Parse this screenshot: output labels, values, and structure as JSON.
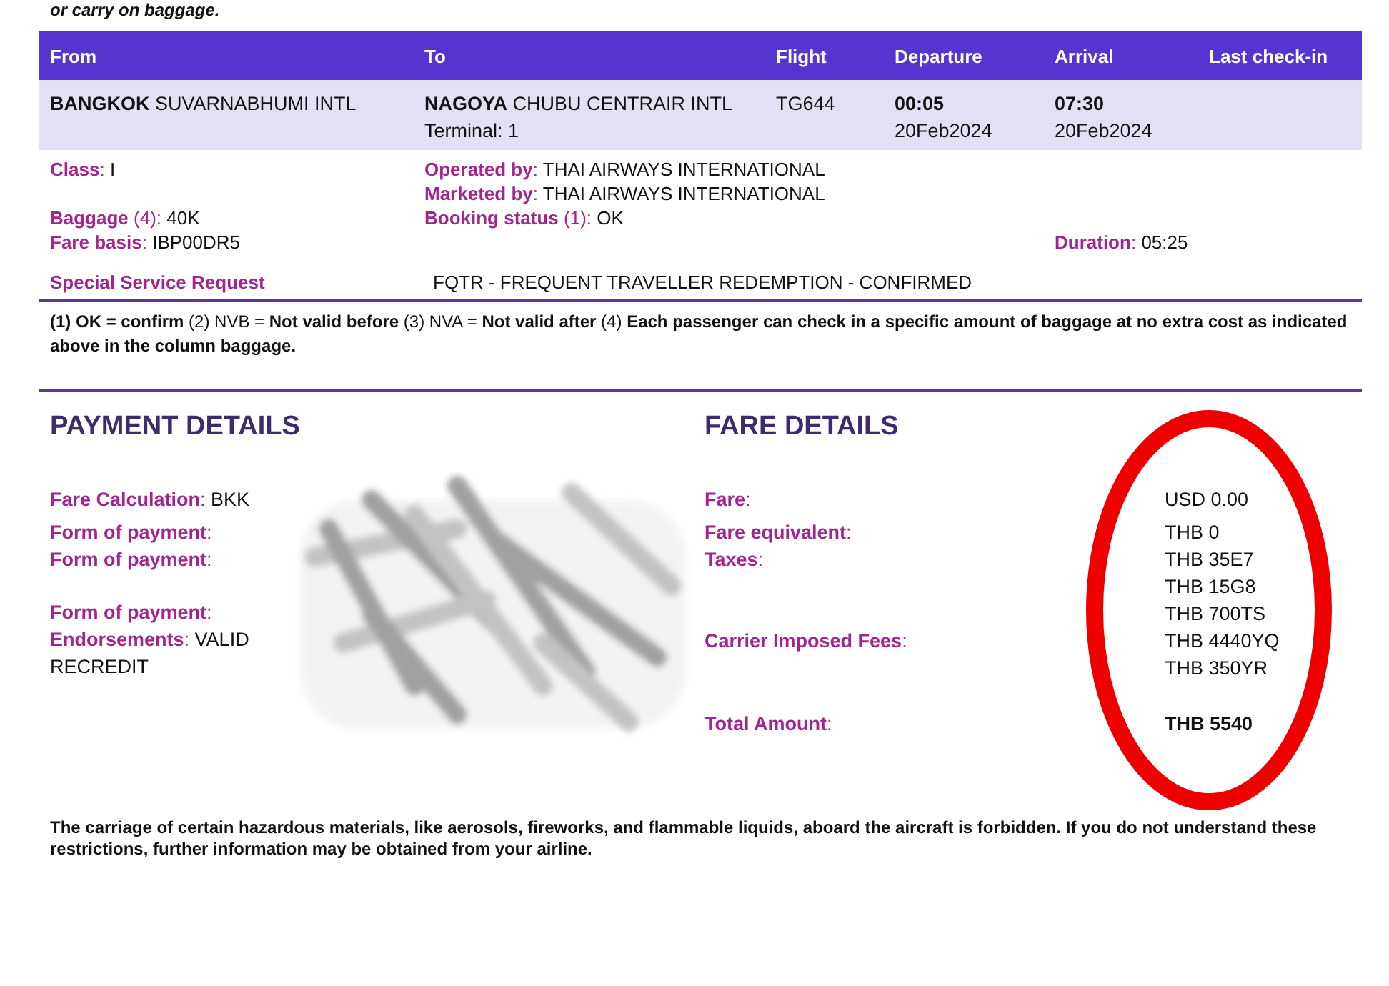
{
  "top_note": "or carry on baggage.",
  "flight_table": {
    "columns": [
      "From",
      "To",
      "Flight",
      "Departure",
      "Arrival",
      "Last check-in"
    ],
    "rows": [
      {
        "from": {
          "city": "BANGKOK",
          "airport": "SUVARNABHUMI INTL"
        },
        "to": {
          "city": "NAGOYA",
          "airport": "CHUBU CENTRAIR INTL",
          "terminal": "Terminal: 1"
        },
        "flight": "TG644",
        "departure": {
          "time": "00:05",
          "date": "20Feb2024"
        },
        "arrival": {
          "time": "07:30",
          "date": "20Feb2024"
        }
      }
    ]
  },
  "details": {
    "class": {
      "label": "**Class**:",
      "value": "I"
    },
    "operated_by": {
      "label": "**Operated by**:",
      "value": "THAI AIRWAYS INTERNATIONAL"
    },
    "marketed_by": {
      "label": "**Marketed by**:",
      "value": "THAI AIRWAYS INTERNATIONAL"
    },
    "baggage": {
      "label": "**Baggage** (4):",
      "value": "40K"
    },
    "booking_status": {
      "label": "**Booking status** (1):",
      "value": "OK"
    },
    "fare_basis": {
      "label": "**Fare basis**:",
      "value": "IBP00DR5"
    },
    "duration": {
      "label": "**Duration**:",
      "value": "05:25"
    },
    "special_service_request": {
      "label": "Special Service Request",
      "value": "FQTR - FREQUENT TRAVELLER REDEMPTION - CONFIRMED"
    }
  },
  "legend": "**(1) OK = confirm** (2) NVB = **Not valid before** (3) NVA = **Not valid after** (4) **Each passenger can check in a specific amount of baggage at no extra cost as indicated above in the column baggage.**",
  "payment_details": {
    "title": "PAYMENT DETAILS",
    "items": [
      {
        "kind": "field",
        "label": "**Fare Calculation**:",
        "value": "BKK"
      },
      {
        "kind": "field",
        "label": "**Form of payment**:"
      },
      {
        "kind": "field",
        "label": "**Form of payment**:"
      },
      {
        "kind": "field",
        "label": "**Form of payment**:"
      },
      {
        "kind": "field",
        "label": "**Endorsements**:",
        "value": "VALID"
      },
      {
        "kind": "continuation",
        "value": "RECREDIT"
      }
    ]
  },
  "fare_details": {
    "title": "FARE DETAILS",
    "items": [
      {
        "kind": "line",
        "label": "**Fare**:",
        "values": [
          "USD 0.00"
        ]
      },
      {
        "kind": "line",
        "label": "**Fare equivalent**:",
        "values": [
          "THB 0"
        ]
      },
      {
        "kind": "line",
        "label": "**Taxes**:",
        "values": [
          "THB 35E7",
          "THB 15G8",
          "THB 700TS"
        ]
      },
      {
        "kind": "line",
        "label": "**Carrier Imposed Fees**:",
        "values": [
          "THB 4440YQ",
          "THB 350YR"
        ]
      },
      {
        "kind": "total",
        "label": "**Total Amount**:",
        "values": [
          "THB 5540"
        ]
      }
    ]
  },
  "footer": "The carriage of certain hazardous materials, like aerosols, fireworks, and flammable liquids, aboard the aircraft is forbidden. If you do not understand these restrictions, further information may be obtained from your airline."
}
